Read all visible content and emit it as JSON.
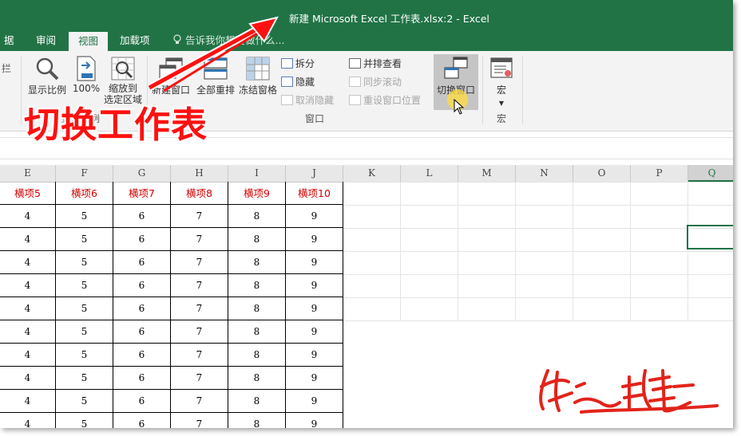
{
  "window": {
    "title": "新建 Microsoft Excel 工作表.xlsx:2 - Excel"
  },
  "tabs": {
    "partial_left": "据",
    "review": "审阅",
    "view": "视图",
    "addins": "加载项",
    "tell_me": "告诉我你想要做什么..."
  },
  "ribbon": {
    "partial_left_text": "拦",
    "zoom_label": "显示比例",
    "zoom100_label": "100%",
    "zoom_selection_line1": "缩放到",
    "zoom_selection_line2": "选定区域",
    "zoom_group_label": "显示比例",
    "new_window_label": "新建窗口",
    "arrange_all_label": "全部重排",
    "freeze_panes_label": "冻结窗格",
    "split_label": "拆分",
    "hide_label": "隐藏",
    "unhide_label": "取消隐藏",
    "side_by_side_label": "并排查看",
    "sync_scroll_label": "同步滚动",
    "reset_position_label": "重设窗口位置",
    "switch_windows_label": "切换窗口",
    "window_group_label": "窗口",
    "macros_label": "宏",
    "macros_group_label": "宏"
  },
  "overlay": {
    "caption": "切换工作表",
    "colors": {
      "annotation_red": "#ff1010"
    }
  },
  "sheet": {
    "columns": [
      "E",
      "F",
      "G",
      "H",
      "I",
      "J",
      "K",
      "L",
      "M",
      "N",
      "O",
      "P",
      "Q"
    ],
    "selected_column": "Q",
    "header_row": [
      "横项5",
      "横项6",
      "横项7",
      "横项8",
      "横项9",
      "横项10"
    ],
    "data_row": [
      "4",
      "5",
      "6",
      "7",
      "8",
      "9"
    ],
    "data_row_count": 10
  },
  "colors": {
    "excel_green": "#217346",
    "header_red": "#d40000"
  }
}
